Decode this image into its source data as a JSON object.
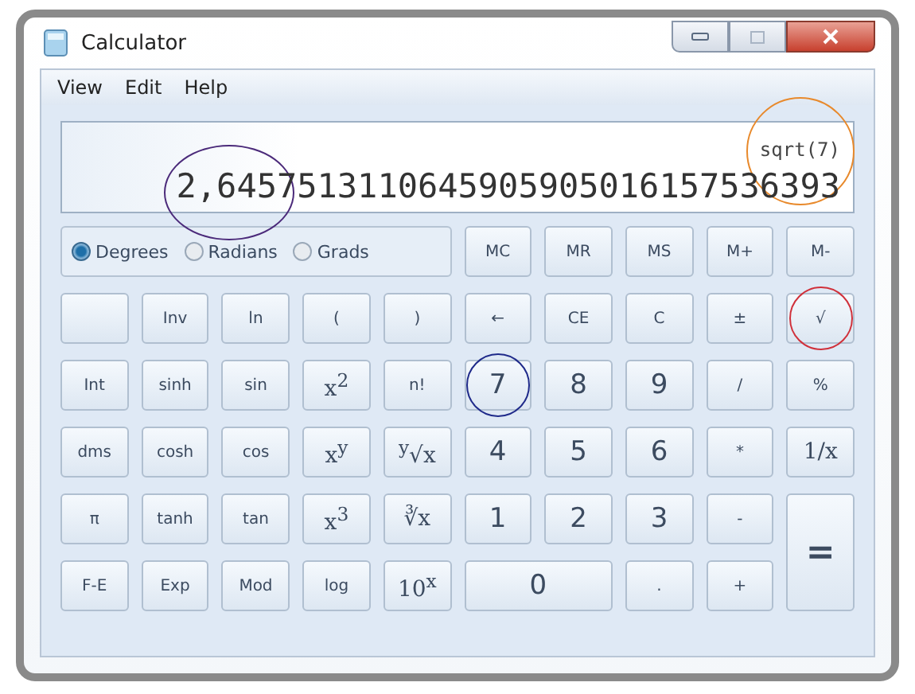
{
  "window": {
    "title": "Calculator"
  },
  "menu": [
    "View",
    "Edit",
    "Help"
  ],
  "display": {
    "expression": {
      "text": "sqrt(7)",
      "color": "#e8892b"
    },
    "value": [
      {
        "text": "2,645",
        "color": "#4b2a7a"
      },
      {
        "text": "7513110645905905016157536393"
      }
    ]
  },
  "angle_units": [
    {
      "label": "Degrees",
      "selected": true
    },
    {
      "label": "Radians",
      "selected": false
    },
    {
      "label": "Grads",
      "selected": false
    }
  ],
  "keys": [
    {
      "label": "MC",
      "kind": "key"
    },
    {
      "label": "MR",
      "kind": "key"
    },
    {
      "label": "MS",
      "kind": "key"
    },
    {
      "label": "M+",
      "kind": "key"
    },
    {
      "label": "M-",
      "kind": "key"
    },
    {
      "kind": "blank"
    },
    {
      "label": "Inv",
      "kind": "key"
    },
    {
      "label": "ln",
      "kind": "key"
    },
    {
      "label": "(",
      "kind": "key"
    },
    {
      "label": ")",
      "kind": "key"
    },
    {
      "label": "←",
      "kind": "key"
    },
    {
      "label": "CE",
      "kind": "key"
    },
    {
      "label": "C",
      "kind": "key"
    },
    {
      "label": "±",
      "kind": "key"
    },
    {
      "label": "√",
      "kind": "key",
      "color": "#d0303a"
    },
    {
      "label": "Int",
      "kind": "key"
    },
    {
      "label": "sinh",
      "kind": "key"
    },
    {
      "label": "sin",
      "kind": "key"
    },
    {
      "label": "x$^{2}$",
      "kind": "math"
    },
    {
      "label": "n!",
      "kind": "key"
    },
    {
      "label": "7",
      "kind": "digit",
      "color": "#1f2a8a"
    },
    {
      "label": "8",
      "kind": "digit"
    },
    {
      "label": "9",
      "kind": "digit"
    },
    {
      "label": "/",
      "kind": "key"
    },
    {
      "label": "%",
      "kind": "key"
    },
    {
      "label": "dms",
      "kind": "key"
    },
    {
      "label": "cosh",
      "kind": "key"
    },
    {
      "label": "cos",
      "kind": "key"
    },
    {
      "label": "x$^{y}$",
      "kind": "math"
    },
    {
      "label": "$^{y}$√x",
      "kind": "math"
    },
    {
      "label": "4",
      "kind": "digit"
    },
    {
      "label": "5",
      "kind": "digit"
    },
    {
      "label": "6",
      "kind": "digit"
    },
    {
      "label": "*",
      "kind": "key"
    },
    {
      "label": "1/x",
      "kind": "math"
    },
    {
      "label": "π",
      "kind": "key"
    },
    {
      "label": "tanh",
      "kind": "key"
    },
    {
      "label": "tan",
      "kind": "key"
    },
    {
      "label": "x$^{3}$",
      "kind": "math"
    },
    {
      "label": "∛x",
      "kind": "math"
    },
    {
      "label": "1",
      "kind": "digit"
    },
    {
      "label": "2",
      "kind": "digit"
    },
    {
      "label": "3",
      "kind": "digit"
    },
    {
      "label": "-",
      "kind": "key"
    },
    {
      "label": "=",
      "kind": "tall"
    },
    {
      "label": "F-E",
      "kind": "key"
    },
    {
      "label": "Exp",
      "kind": "key"
    },
    {
      "label": "Mod",
      "kind": "key"
    },
    {
      "label": "log",
      "kind": "key"
    },
    {
      "label": "10$^{x}$",
      "kind": "math"
    },
    {
      "label": "0",
      "kind": "wide"
    },
    {
      "label": ".",
      "kind": "key"
    },
    {
      "label": "+",
      "kind": "key"
    }
  ]
}
